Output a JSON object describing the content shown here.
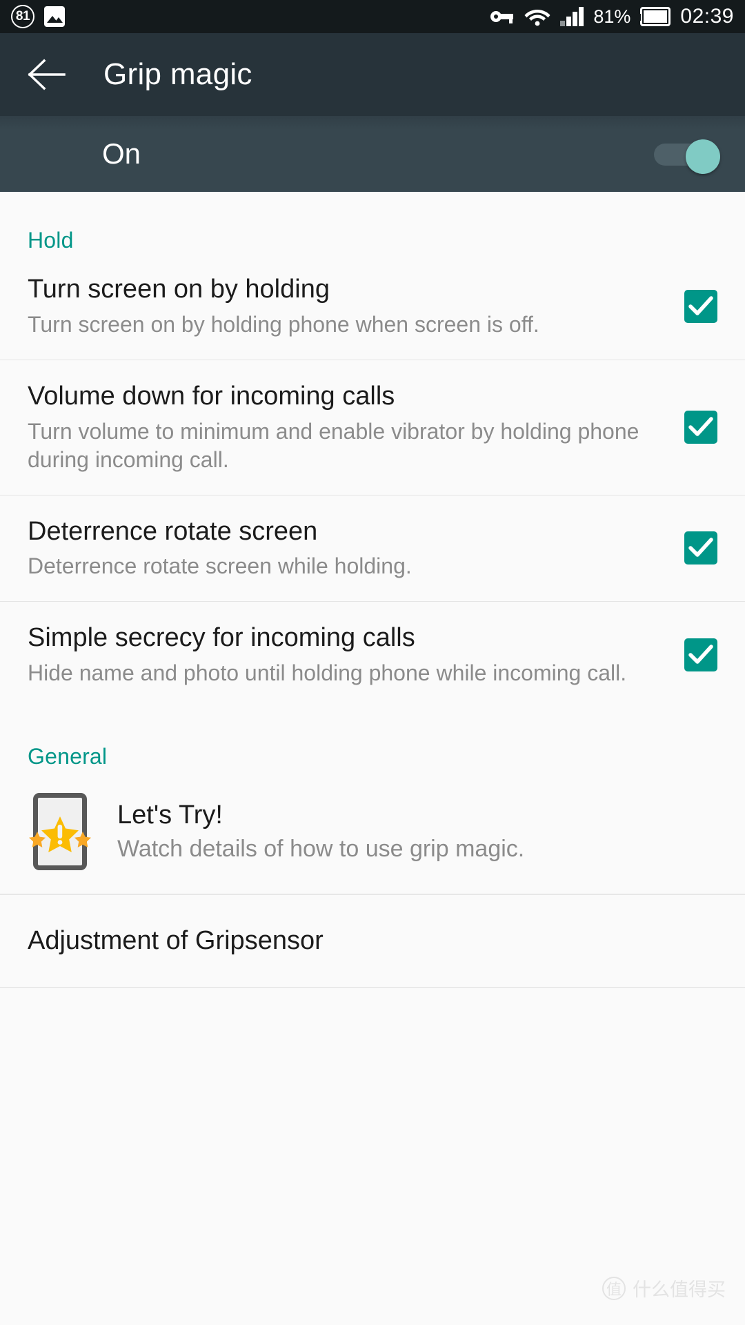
{
  "status_bar": {
    "notification_badge": "81",
    "gallery_icon": "image-icon",
    "vpn_icon": "key-icon",
    "wifi_icon": "wifi-icon",
    "signal_icon": "signal-bars-icon",
    "signal_bars_filled": 3,
    "signal_bars_total": 4,
    "battery_percent": "81%",
    "battery_icon": "battery-icon",
    "clock": "02:39"
  },
  "app_bar": {
    "back_icon": "back-arrow-icon",
    "title": "Grip magic"
  },
  "master_switch": {
    "label": "On",
    "state": "on",
    "accent": "#80cbc4"
  },
  "colors": {
    "accent_teal": "#009688",
    "app_bar_bg": "#27333a",
    "switch_row_bg": "#37474f",
    "page_bg": "#fafafa",
    "title_text": "#1b1b1b",
    "summary_text": "#8b8b8b"
  },
  "sections": [
    {
      "header": "Hold",
      "items": [
        {
          "title": "Turn screen on by holding",
          "summary": "Turn screen on by holding phone when screen is off.",
          "checked": true
        },
        {
          "title": "Volume down for incoming calls",
          "summary": "Turn volume to minimum and enable vibrator by holding phone during incoming call.",
          "checked": true
        },
        {
          "title": "Deterrence rotate screen",
          "summary": "Deterrence rotate screen while holding.",
          "checked": true
        },
        {
          "title": "Simple secrecy for incoming calls",
          "summary": "Hide name and photo until holding phone while incoming call.",
          "checked": true
        }
      ]
    },
    {
      "header": "General",
      "trial": {
        "icon": "phone-with-stars-icon",
        "title": "Let's Try!",
        "summary": "Watch details of how to use grip magic."
      },
      "adjustment": {
        "title": "Adjustment of Gripsensor"
      }
    }
  ],
  "watermark": {
    "logo_char": "值",
    "text": "什么值得买"
  }
}
